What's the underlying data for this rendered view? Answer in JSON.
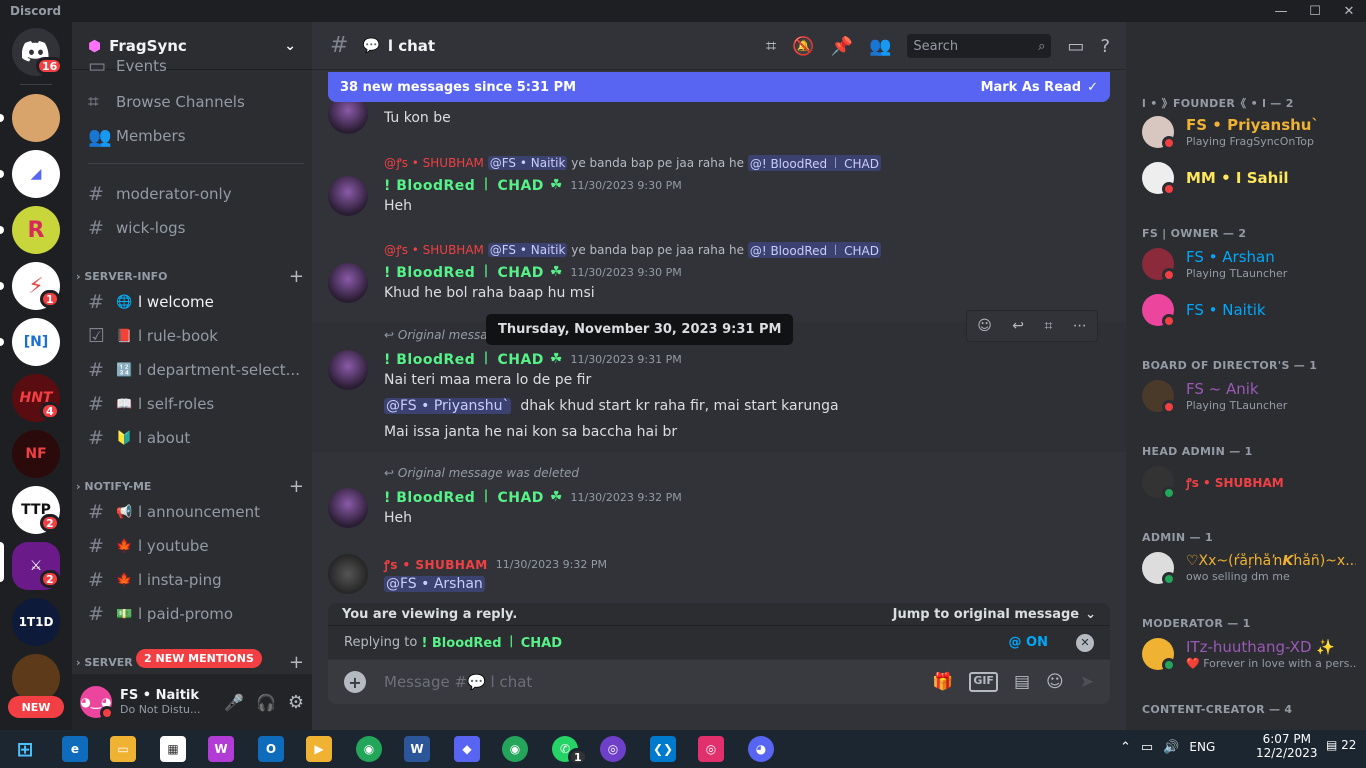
{
  "app": {
    "title": "Discord",
    "win_min": "—",
    "win_max": "☐",
    "win_close": "✕"
  },
  "guilds": {
    "home_badge": "16",
    "badges": {
      "g5": "1",
      "g7": "4",
      "g9": "2",
      "g10": "2"
    },
    "new_label": "NEW",
    "labels": {
      "g3": "R",
      "g5": "⚡",
      "g6": "[N]",
      "g7": "HNT",
      "g8": "NF",
      "g9": "TTP",
      "g10": "⚔",
      "g11": "1T1D"
    }
  },
  "server": {
    "name": "FragSync",
    "events": "Events",
    "browse": "Browse Channels",
    "members": "Members",
    "channels_top": [
      {
        "name": "moderator-only"
      },
      {
        "name": "wick-logs"
      }
    ],
    "cat1": "SERVER-INFO",
    "cat1_channels": [
      {
        "emoji": "🌐",
        "name": "l welcome"
      },
      {
        "emoji": "📕",
        "name": "l rule-book"
      },
      {
        "emoji": "🔢",
        "name": "l department-select..."
      },
      {
        "emoji": "📖",
        "name": "l self-roles"
      },
      {
        "emoji": "🔰",
        "name": "l about"
      }
    ],
    "cat2": "NOTIFY-ME",
    "cat2_channels": [
      {
        "emoji": "📢",
        "name": "l announcement"
      },
      {
        "emoji": "🍁",
        "name": "l youtube"
      },
      {
        "emoji": "🍁",
        "name": "l insta-ping"
      },
      {
        "emoji": "💵",
        "name": "l paid-promo"
      }
    ],
    "cat3": "SERVER",
    "new_mentions": "2 NEW MENTIONS"
  },
  "user": {
    "name": "FS • Naitik",
    "status": "Do Not Distu..."
  },
  "channel": {
    "title": "l chat",
    "search_placeholder": "Search"
  },
  "new_messages": {
    "text": "38 new messages since 5:31 PM",
    "mark": "Mark As Read"
  },
  "messages": [
    {
      "user": "! BloodRed ꒐ CHAD",
      "time": "11/30/2023 9:30 PM",
      "text": "Tu kon be"
    },
    {
      "reply_user": "@ꝭs • SHUBHAM",
      "reply_mention1": "@FS • Naitik",
      "reply_text": "ye banda bap pe jaa raha he",
      "reply_mention2": "@! BloodRed ꒐ CHAD",
      "user": "! BloodRed ꒐ CHAD",
      "time": "11/30/2023 9:30 PM",
      "text": "Heh"
    },
    {
      "reply_user": "@ꝭs • SHUBHAM",
      "reply_mention1": "@FS • Naitik",
      "reply_text": "ye banda bap pe jaa raha he",
      "reply_mention2": "@! BloodRed ꒐ CHAD",
      "user": "! BloodRed ꒐ CHAD",
      "time": "11/30/2023 9:30 PM",
      "text": "Khud he bol raha baap hu msi"
    },
    {
      "reply_text": "Original messa",
      "user": "! BloodRed ꒐ CHAD",
      "time": "11/30/2023 9:31 PM",
      "text": "Nai teri maa mera lo de pe fir",
      "text2_mention": "@FS • Priyanshu`",
      "text2": "dhak khud start kr raha fir, mai start karunga",
      "text3": "Mai issa janta he nai kon sa baccha hai br"
    },
    {
      "reply_text": "Original message was deleted",
      "user": "! BloodRed ꒐ CHAD",
      "time": "11/30/2023 9:32 PM",
      "text": "Heh"
    },
    {
      "user": "ꝭs • SHUBHAM",
      "time": "11/30/2023 9:32 PM",
      "text": "@FS • Arshan"
    }
  ],
  "tooltip": "Thursday, November 30, 2023 9:31 PM",
  "viewing": {
    "text": "You are viewing a reply.",
    "jump": "Jump to original message"
  },
  "replying": {
    "prefix": "Replying to",
    "user": "! BloodRed ꒐ CHAD",
    "on": "@ ON"
  },
  "composer": {
    "placeholder": "Message #💬 l chat"
  },
  "member_list": [
    {
      "cat": "l • 》FOUNDER《 • l — 2",
      "members": [
        {
          "name": "FS • Priyanshu`",
          "activity": "Playing FragSyncOnTop",
          "color": "#f0b232"
        },
        {
          "name": "MM • I Sahil",
          "activity": "",
          "color": "#fee75c"
        }
      ]
    },
    {
      "cat": "FS | OWNER — 2",
      "members": [
        {
          "name": "FS • Arshan",
          "activity": "Playing TLauncher",
          "color": "#00a8fc"
        },
        {
          "name": "FS • Naitik",
          "activity": "",
          "color": "#00a8fc"
        }
      ]
    },
    {
      "cat": "BOARD OF DIRECTOR'S — 1",
      "members": [
        {
          "name": "FS ~ Anik",
          "activity": "Playing TLauncher",
          "color": "#9b59b6"
        }
      ]
    },
    {
      "cat": "HEAD ADMIN — 1",
      "members": [
        {
          "name": "ꝭs • SHUBHAM",
          "activity": "",
          "color": "#f23f43"
        }
      ]
    },
    {
      "cat": "ADMIN — 1",
      "members": [
        {
          "name": "♡Xx~(ŕåŗĥåŉ𝙆ĥåñ)~x...",
          "activity": "owo selling dm me",
          "color": "#f0b232"
        }
      ]
    },
    {
      "cat": "MODERATOR — 1",
      "members": [
        {
          "name": "ITz-huuthang-XD ✨",
          "activity": "❤️ Forever in love with a pers...",
          "color": "#9b59b6"
        }
      ]
    },
    {
      "cat": "CONTENT-CREATOR — 4",
      "members": []
    }
  ],
  "taskbar": {
    "time": "6:07 PM",
    "date": "12/2/2023",
    "lang": "ENG",
    "notif": "22",
    "whatsapp_badge": "1"
  },
  "colors": {
    "accent": "#5865f2",
    "bg": "#313338",
    "sidebar": "#2b2d31",
    "guild": "#1e1f22"
  }
}
